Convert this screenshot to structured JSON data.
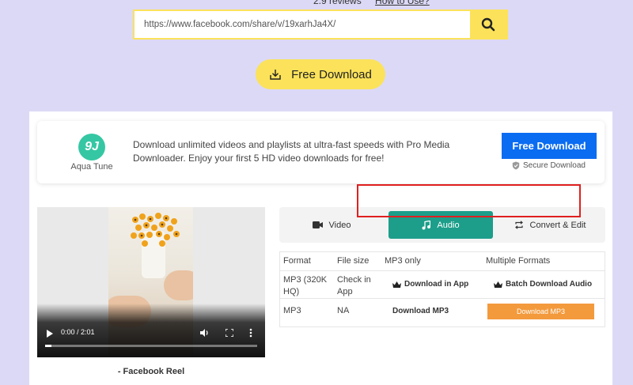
{
  "top": {
    "reviews_text": "2.9 reviews",
    "how_to_use_text": "How to Use?"
  },
  "search": {
    "url_value": "https://www.facebook.com/share/v/19xarhJa4X/",
    "search_icon": "search-icon"
  },
  "free_download": {
    "label": "Free Download",
    "icon": "download-tray-icon"
  },
  "promo": {
    "logo_mark": "9J",
    "brand": "Aqua Tune",
    "text": "Download unlimited videos and playlists at ultra-fast speeds with Pro Media Downloader. Enjoy your first 5 HD video downloads for free!",
    "button_label": "Free Download",
    "secure_label": "Secure Download",
    "button_color": "#0a6cf1"
  },
  "video": {
    "time": "0:00 / 2:01",
    "caption": "- Facebook Reel",
    "progress_fraction": 0.0
  },
  "tabs": [
    {
      "label": "Video",
      "icon": "video-camera-icon",
      "active": false
    },
    {
      "label": "Audio",
      "icon": "music-note-icon",
      "active": true
    },
    {
      "label": "Convert & Edit",
      "icon": "convert-arrows-icon",
      "active": false
    }
  ],
  "table": {
    "headers": [
      "Format",
      "File size",
      "MP3 only",
      "Multiple Formats"
    ],
    "rows": [
      {
        "format": "MP3 (320K HQ)",
        "size": "Check in App",
        "mp3_only": "Download in App",
        "multiple": "Batch Download Audio"
      },
      {
        "format": "MP3",
        "size": "NA",
        "mp3_only": "Download MP3",
        "multiple": "Download MP3"
      }
    ]
  },
  "colors": {
    "accent_yellow": "#fbe25a",
    "active_tab": "#1c9e8a",
    "orange_button": "#f39a3c",
    "highlight_red": "#e02020"
  }
}
